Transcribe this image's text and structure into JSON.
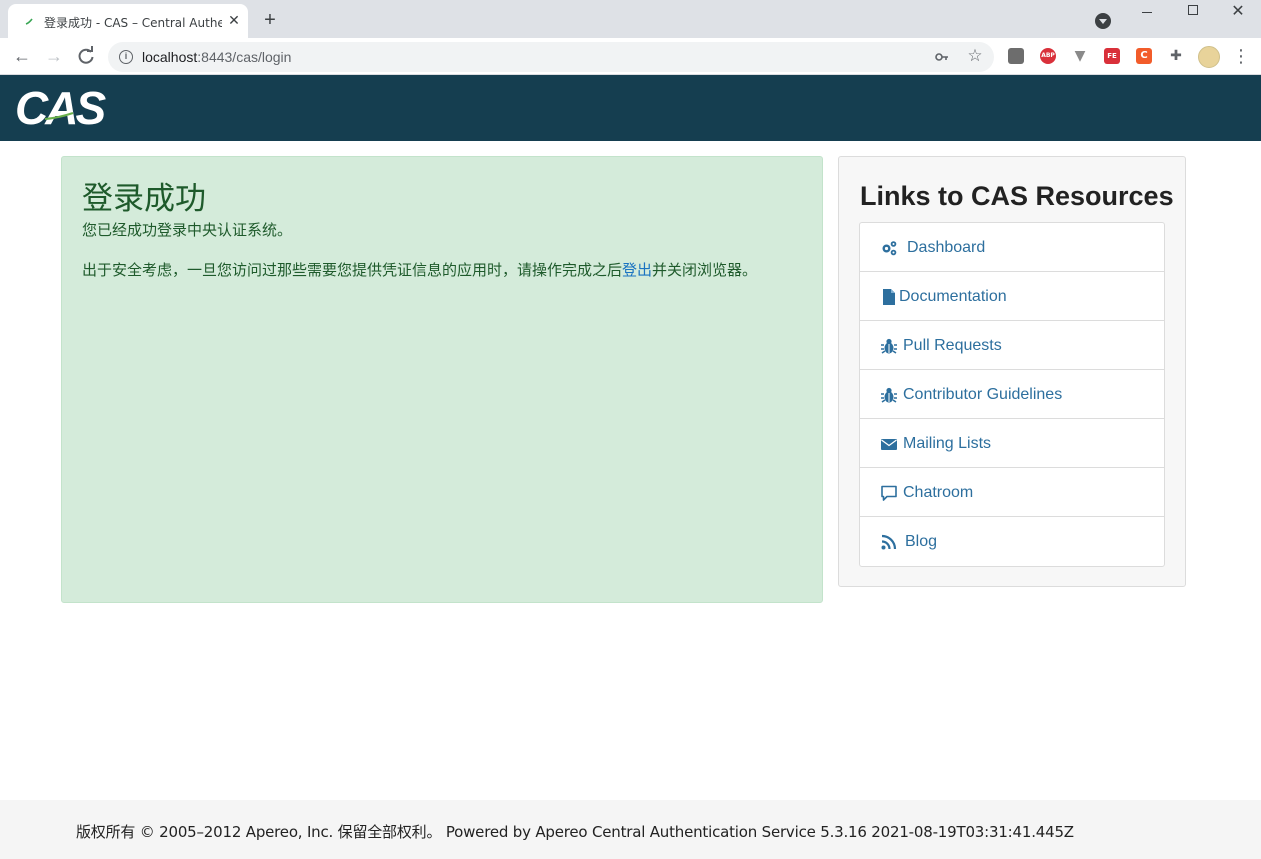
{
  "browser": {
    "tab_title": "登录成功 - CAS – Central Authe",
    "tab_close": "✕",
    "new_tab": "+",
    "url_host": "localhost",
    "url_rest": ":8443/cas/login",
    "extensions": {
      "abp": "ABP",
      "fe": "FE",
      "c": "C"
    }
  },
  "header": {
    "logo_text": "CAS"
  },
  "main": {
    "title": "登录成功",
    "subtitle": "您已经成功登录中央认证系统。",
    "warning_prefix": "出于安全考虑，一旦您访问过那些需要您提供凭证信息的应用时，请操作完成之后",
    "warning_link": "登出",
    "warning_suffix": "并关闭浏览器。"
  },
  "resources": {
    "title": "Links to CAS Resources",
    "items": [
      {
        "label": "Dashboard",
        "icon": "cogs-icon"
      },
      {
        "label": "Documentation",
        "icon": "file-icon"
      },
      {
        "label": "Pull Requests",
        "icon": "bug-icon"
      },
      {
        "label": "Contributor Guidelines",
        "icon": "bug-icon"
      },
      {
        "label": "Mailing Lists",
        "icon": "envelope-icon"
      },
      {
        "label": "Chatroom",
        "icon": "comment-icon"
      },
      {
        "label": "Blog",
        "icon": "rss-icon"
      }
    ]
  },
  "footer": {
    "text": "版权所有 © 2005–2012 Apereo, Inc. 保留全部权利。 Powered by Apereo Central Authentication Service 5.3.16 2021-08-19T03:31:41.445Z"
  },
  "colors": {
    "header_bg": "#153e50",
    "success_bg": "#d4ebda",
    "success_text": "#1e5a2b",
    "link": "#2d6f9e"
  }
}
